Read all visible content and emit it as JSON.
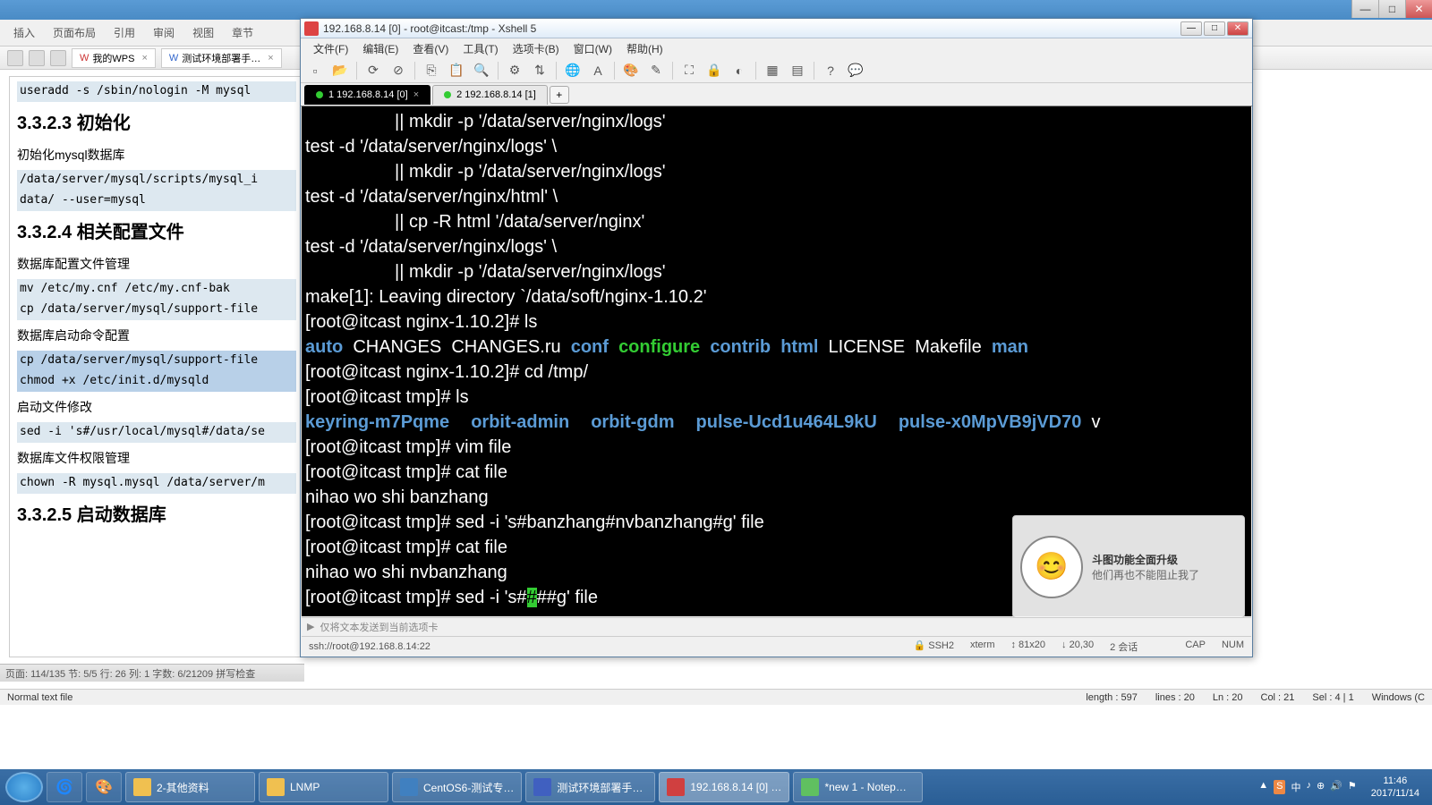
{
  "wps": {
    "ribbon": {
      "insert": "插入",
      "page": "页面布局",
      "ref": "引用",
      "review": "审阅",
      "view": "视图",
      "section": "章节"
    },
    "tabs": {
      "mywps": "我的WPS",
      "doc": "测试环境部署手…"
    },
    "statusbar": "页面: 114/135  节: 5/5  行: 26  列: 1  字数: 6/21209  拼写检查"
  },
  "doc": {
    "l1": "useradd -s /sbin/nologin -M mysql",
    "h1": "3.3.2.3 初始化",
    "s1": "初始化mysql数据库",
    "l2": "/data/server/mysql/scripts/mysql_i",
    "l3": "data/ --user=mysql",
    "h2": "3.3.2.4 相关配置文件",
    "s2": "数据库配置文件管理",
    "l4": "mv /etc/my.cnf /etc/my.cnf-bak",
    "l5": "cp /data/server/mysql/support-file",
    "s3": "数据库启动命令配置",
    "l6": "cp /data/server/mysql/support-file",
    "l7": "chmod +x /etc/init.d/mysqld",
    "s4": "启动文件修改",
    "l8": "sed -i 's#/usr/local/mysql#/data/se",
    "s5": "数据库文件权限管理",
    "l9": "chown -R mysql.mysql /data/server/m",
    "h3": "3.3.2.5 启动数据库"
  },
  "xshell": {
    "title": "192.168.8.14 [0] - root@itcast:/tmp - Xshell 5",
    "menu": {
      "file": "文件(F)",
      "edit": "编辑(E)",
      "view": "查看(V)",
      "tools": "工具(T)",
      "tabs": "选项卡(B)",
      "window": "窗口(W)",
      "help": "帮助(H)"
    },
    "tab1": "1 192.168.8.14 [0]",
    "tab2": "2 192.168.8.14 [1]",
    "inputbar": "仅将文本发送到当前选项卡",
    "status": {
      "conn": "ssh://root@192.168.8.14:22",
      "ssh": "SSH2",
      "term": "xterm",
      "size": "81x20",
      "pos": "20,30",
      "sess": "2 会话",
      "cap": "CAP",
      "num": "NUM"
    }
  },
  "term": {
    "t1": "                  || mkdir -p '/data/server/nginx/logs'",
    "t2": "test -d '/data/server/nginx/logs' \\",
    "t3": "                  || mkdir -p '/data/server/nginx/logs'",
    "t4": "test -d '/data/server/nginx/html' \\",
    "t5": "                  || cp -R html '/data/server/nginx'",
    "t6": "test -d '/data/server/nginx/logs' \\",
    "t7": "                  || mkdir -p '/data/server/nginx/logs'",
    "t8": "make[1]: Leaving directory `/data/soft/nginx-1.10.2'",
    "t9": "[root@itcast nginx-1.10.2]# ls",
    "ls1": {
      "auto": "auto",
      "changes": "  CHANGES  CHANGES.ru  ",
      "conf": "conf",
      "sp1": "  ",
      "configure": "configure",
      "sp2": "  ",
      "contrib": "contrib",
      "sp3": "  ",
      "html": "html",
      "rest": "  LICENSE  Makefile  ",
      "man": "man"
    },
    "t10": "[root@itcast nginx-1.10.2]# cd /tmp/",
    "t11": "[root@itcast tmp]# ls",
    "ls2": {
      "a": "keyring-m7Pqme",
      "b": "orbit-admin",
      "c": "orbit-gdm",
      "d": "pulse-Ucd1u464L9kU",
      "e": "pulse-x0MpVB9jVD70",
      "v": "  v"
    },
    "t12": "[root@itcast tmp]# vim file",
    "t13": "[root@itcast tmp]# cat file",
    "t14": "nihao wo shi banzhang",
    "t15": "[root@itcast tmp]# sed -i 's#banzhang#nvbanzhang#g' file",
    "t16": "[root@itcast tmp]# cat file",
    "t17": "nihao wo shi nvbanzhang",
    "t18a": "[root@itcast tmp]# sed -i 's#",
    "t18c": "##g' file"
  },
  "toast": {
    "title": "斗图功能全面升级",
    "sub": "他们再也不能阻止我了"
  },
  "npp": {
    "left": "Normal text file",
    "len": "length : 597",
    "lines": "lines : 20",
    "ln": "Ln : 20",
    "col": "Col : 21",
    "sel": "Sel : 4 | 1",
    "win": "Windows (C"
  },
  "taskbar": {
    "t1": "2-其他资料",
    "t2": "LNMP",
    "t3": "CentOS6-测试专…",
    "t4": "测试环境部署手…",
    "t5": "192.168.8.14 [0] …",
    "t6": "*new 1 - Notep…",
    "time": "11:46",
    "date": "2017/11/14"
  }
}
